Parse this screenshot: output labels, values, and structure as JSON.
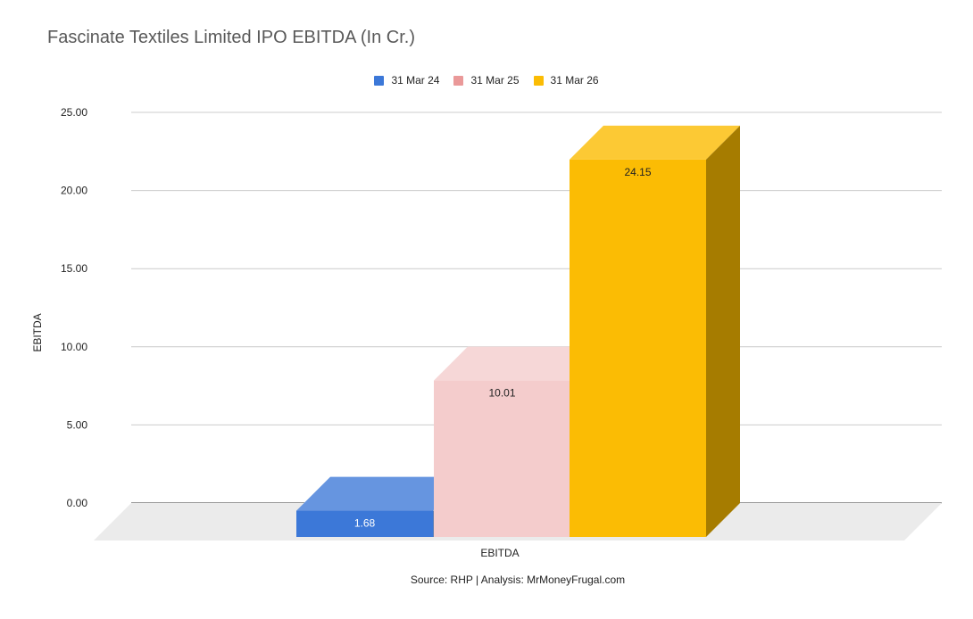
{
  "chart_data": {
    "type": "bar",
    "title": "Fascinate Textiles Limited IPO EBITDA (In Cr.)",
    "categories": [
      "EBITDA"
    ],
    "xlabel": "EBITDA",
    "ylabel": "EBITDA",
    "ylim": [
      0,
      25
    ],
    "yticks": [
      "0.00",
      "5.00",
      "10.00",
      "15.00",
      "20.00",
      "25.00"
    ],
    "series": [
      {
        "name": "31 Mar 24",
        "values": [
          1.68
        ],
        "label": "1.68",
        "color": "#3c78d8"
      },
      {
        "name": "31 Mar 25",
        "values": [
          10.01
        ],
        "label": "10.01",
        "color": "#f4cccc"
      },
      {
        "name": "31 Mar 26",
        "values": [
          24.15
        ],
        "label": "24.15",
        "color": "#fbbc04"
      }
    ],
    "grid": true,
    "legend": "top-center",
    "source": "Source: RHP | Analysis: MrMoneyFrugal.com"
  }
}
